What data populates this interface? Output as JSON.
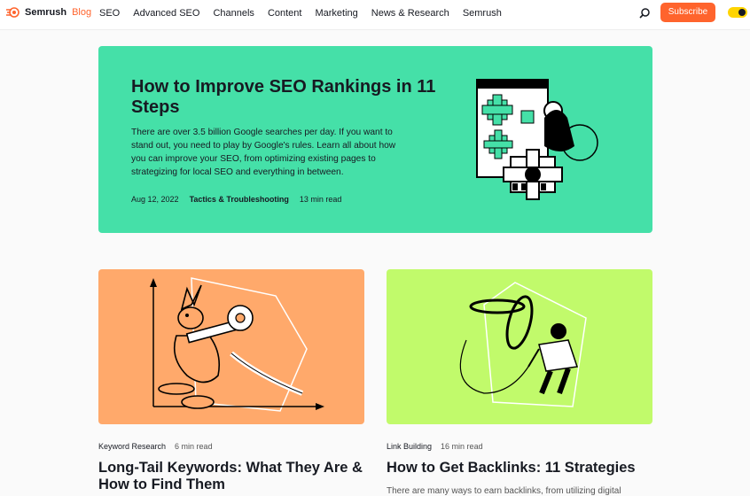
{
  "brand": {
    "name": "Semrush",
    "section": "Blog"
  },
  "nav": {
    "items": [
      "SEO",
      "Advanced SEO",
      "Channels",
      "Content",
      "Marketing",
      "News & Research",
      "Semrush"
    ],
    "subscribe_label": "Subscribe"
  },
  "hero": {
    "title": "How to Improve SEO Rankings in 11 Steps",
    "description": "There are over 3.5 billion Google searches per day. If you want to stand out, you need to play by Google's rules. Learn all about how you can improve your SEO, from optimizing existing pages to strategizing for local SEO and everything in between.",
    "date": "Aug 12, 2022",
    "category": "Tactics & Troubleshooting",
    "read_time": "13 min read"
  },
  "cards": [
    {
      "category": "Keyword Research",
      "read_time": "6 min read",
      "title": "Long-Tail Keywords: What They Are & How to Find Them"
    },
    {
      "category": "Link Building",
      "read_time": "16 min read",
      "title": "How to Get Backlinks: 11 Strategies",
      "description": "There are many ways to earn backlinks, from utilizing digital"
    }
  ],
  "colors": {
    "accent": "#ff642d",
    "hero_bg": "#45e0a8",
    "card1_bg": "#ffa96b",
    "card2_bg": "#c1fa6b",
    "toggle": "#ffd400"
  },
  "icons": {
    "logo": "semrush-fire-icon",
    "search": "search-icon",
    "theme": "theme-toggle"
  }
}
